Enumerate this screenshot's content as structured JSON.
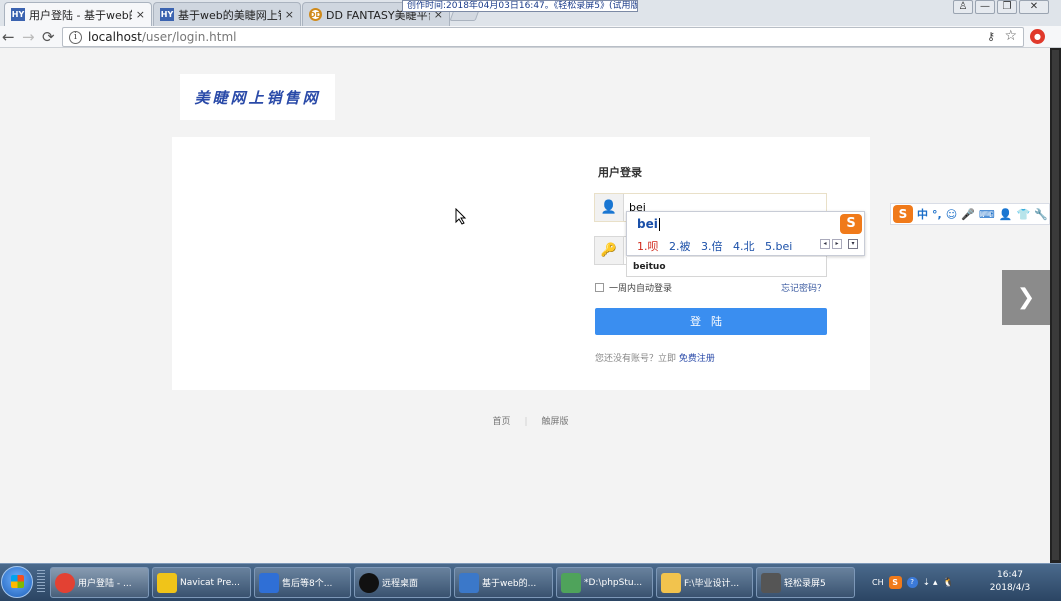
{
  "recording_banner": "创作时间:2018年04月03日16:47。《轻松录屏5》(试用版)",
  "tabs": [
    {
      "favicon": "HY",
      "title": "用户登陆 - 基于web的美",
      "close": "×"
    },
    {
      "favicon": "HY",
      "title": "基于web的美睫网上销售",
      "close": "×"
    },
    {
      "favicon": "DD",
      "title": "DD FANTASY美睫平台",
      "close": "×"
    }
  ],
  "window_controls": {
    "user": "♙",
    "minimize": "—",
    "restore": "❐",
    "close": "✕"
  },
  "nav": {
    "back": "←",
    "forward": "→",
    "reload": "⟳"
  },
  "address": {
    "host": "localhost",
    "path": "/user/login.html",
    "info_icon": "i",
    "key_icon": "⚷",
    "star_icon": "☆"
  },
  "extension": {
    "label": "●"
  },
  "logo": {
    "text": "美睫网上销售网"
  },
  "login": {
    "title": "用户登录",
    "username_value": "bei",
    "password_value": "",
    "user_icon": "👤",
    "key_icon": "🔑",
    "remember_label": "一周内自动登录",
    "forgot_label": "忘记密码？",
    "button_label": "登陆",
    "signup_prefix": "您还没有账号？立即",
    "signup_link": "免费注册"
  },
  "ime": {
    "pinyin": "bei",
    "logo": "S",
    "candidates": [
      "1.呗",
      "2.被",
      "3.倍",
      "4.北",
      "5.bei"
    ],
    "pager_prev": "◂",
    "pager_next": "▸",
    "pager_more": "▾",
    "suggestion": "beituo"
  },
  "sogou_toolbar": {
    "logo": "S",
    "items": [
      "中",
      "°,",
      "☺",
      "🎤",
      "⌨",
      "👤",
      "👕",
      "🔧"
    ]
  },
  "footer": {
    "home": "首页",
    "touch": "触屏版",
    "separator": "|"
  },
  "carousel": {
    "next": "❯"
  },
  "taskbar": {
    "items": [
      {
        "label": "用户登陆 - ...",
        "color": "#e34133"
      },
      {
        "label": "Navicat Pre...",
        "color": "#f0c419"
      },
      {
        "label": "售后等8个...",
        "color": "#2f6fd6"
      },
      {
        "label": "远程桌面",
        "color": "#111111"
      },
      {
        "label": "基于web的...",
        "color": "#3b78c9"
      },
      {
        "label": "*D:\\phpStu...",
        "color": "#4fa35b"
      },
      {
        "label": "F:\\毕业设计...",
        "color": "#f2c34d"
      },
      {
        "label": "轻松录屏5",
        "color": "#555555"
      }
    ],
    "tray": {
      "lang": "CH",
      "sogou": "S",
      "help": "?",
      "arrows": "⇣ ▴",
      "qq": "🐧"
    },
    "clock": {
      "time": "16:47",
      "date": "2018/4/3"
    }
  }
}
